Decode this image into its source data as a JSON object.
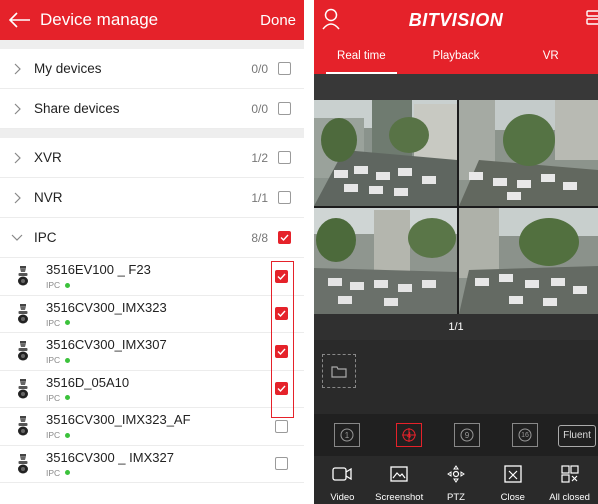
{
  "left": {
    "header": {
      "title": "Device manage",
      "done_label": "Done"
    },
    "groups": [
      {
        "label": "My devices",
        "count": "0/0",
        "checked": false,
        "expanded": false
      },
      {
        "label": "Share devices",
        "count": "0/0",
        "checked": false,
        "expanded": false
      }
    ],
    "types": [
      {
        "label": "XVR",
        "count": "1/2",
        "checked": false,
        "expanded": false
      },
      {
        "label": "NVR",
        "count": "1/1",
        "checked": false,
        "expanded": false
      },
      {
        "label": "IPC",
        "count": "8/8",
        "checked": true,
        "expanded": true
      }
    ],
    "devices": [
      {
        "name": "3516EV100 _ F23",
        "type": "IPC",
        "checked": true
      },
      {
        "name": "3516CV300_IMX323",
        "type": "IPC",
        "checked": true
      },
      {
        "name": "3516CV300_IMX307",
        "type": "IPC",
        "checked": true
      },
      {
        "name": "3516D_05A10",
        "type": "IPC",
        "checked": true
      },
      {
        "name": "3516CV300_IMX323_AF",
        "type": "IPC",
        "checked": false
      },
      {
        "name": "3516CV300 _ IMX327",
        "type": "IPC",
        "checked": false
      }
    ]
  },
  "right": {
    "logo": "BITVISION",
    "tabs": [
      "Real time",
      "Playback",
      "VR"
    ],
    "active_tab": 0,
    "page_indicator": "1/1",
    "split_options": [
      "1",
      "4",
      "9",
      "16"
    ],
    "active_split": "4",
    "stream_label": "Fluent",
    "toolbar": [
      {
        "label": "Video",
        "icon": "video-record-icon"
      },
      {
        "label": "Screenshot",
        "icon": "screenshot-icon"
      },
      {
        "label": "PTZ",
        "icon": "ptz-icon"
      },
      {
        "label": "Close",
        "icon": "close-window-icon"
      },
      {
        "label": "All closed",
        "icon": "close-all-icon"
      }
    ]
  },
  "colors": {
    "accent": "#e5222a",
    "online": "#3cc23c",
    "dark_bg": "#2a2a2a"
  }
}
